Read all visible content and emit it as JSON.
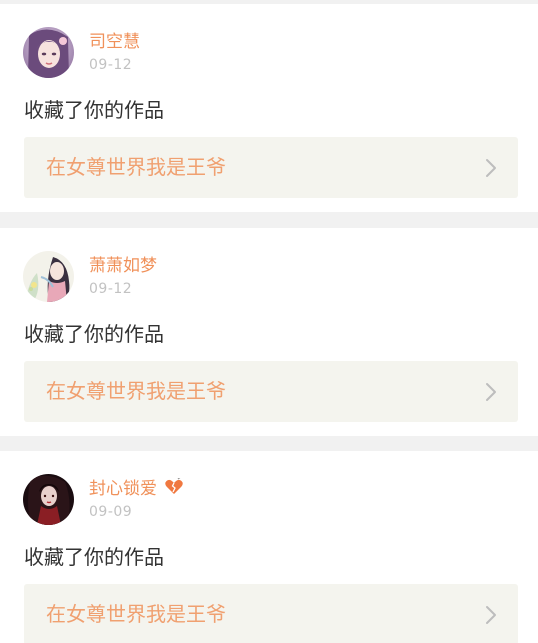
{
  "feed": {
    "items": [
      {
        "user": "司空慧",
        "date": "09-12",
        "action": "收藏了你的作品",
        "work": "在女尊世界我是王爷",
        "avatar_icon": "anime-girl-avatar"
      },
      {
        "user": "萧萧如梦",
        "date": "09-12",
        "action": "收藏了你的作品",
        "work": "在女尊世界我是王爷",
        "avatar_icon": "painted-lady-avatar"
      },
      {
        "user": "封心锁爱",
        "date": "09-09",
        "action": "收藏了你的作品",
        "work": "在女尊世界我是王爷",
        "avatar_icon": "dark-portrait-avatar",
        "badge_icon": "broken-heart-icon"
      }
    ]
  },
  "colors": {
    "username": "#f0915a",
    "work_title": "#f0a070",
    "work_bg": "#f4f4ee",
    "date": "#c2c2c2",
    "text": "#333333",
    "page_bg": "#f1f1f1"
  }
}
